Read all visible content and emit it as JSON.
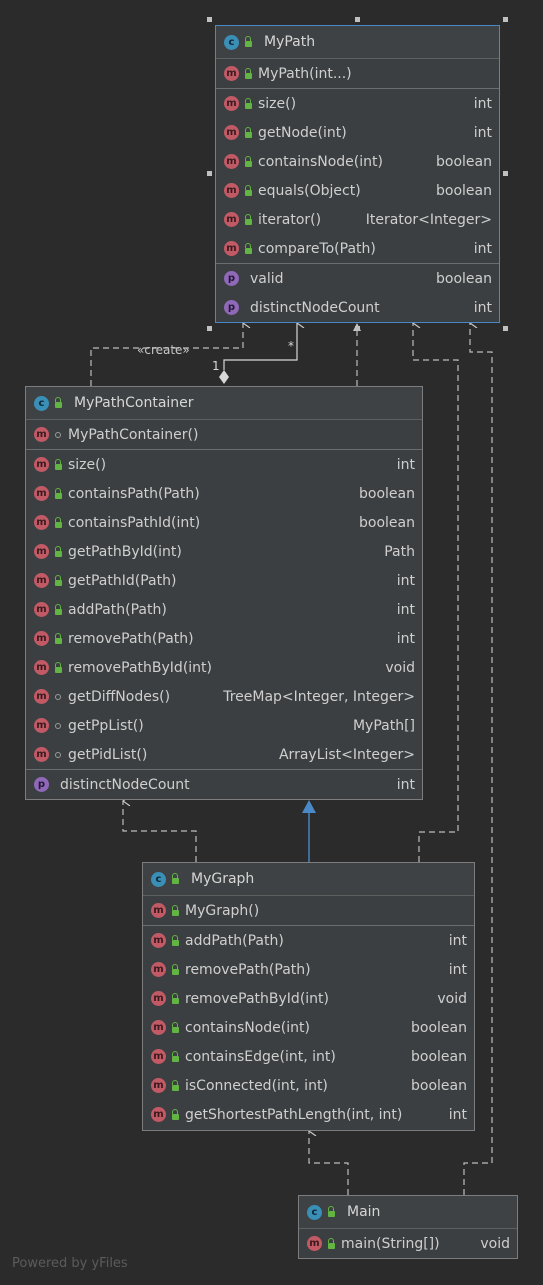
{
  "classes": {
    "mypath": {
      "name": "MyPath",
      "constructors": [
        {
          "name": "MyPath(int...)",
          "type": ""
        }
      ],
      "methods": [
        {
          "name": "size()",
          "type": "int"
        },
        {
          "name": "getNode(int)",
          "type": "int"
        },
        {
          "name": "containsNode(int)",
          "type": "boolean"
        },
        {
          "name": "equals(Object)",
          "type": "boolean"
        },
        {
          "name": "iterator()",
          "type": "Iterator<Integer>"
        },
        {
          "name": "compareTo(Path)",
          "type": "int"
        }
      ],
      "properties": [
        {
          "name": "valid",
          "type": "boolean"
        },
        {
          "name": "distinctNodeCount",
          "type": "int"
        }
      ]
    },
    "container": {
      "name": "MyPathContainer",
      "constructors": [
        {
          "name": "MyPathContainer()",
          "type": ""
        }
      ],
      "methods": [
        {
          "name": "size()",
          "type": "int"
        },
        {
          "name": "containsPath(Path)",
          "type": "boolean"
        },
        {
          "name": "containsPathId(int)",
          "type": "boolean"
        },
        {
          "name": "getPathById(int)",
          "type": "Path"
        },
        {
          "name": "getPathId(Path)",
          "type": "int"
        },
        {
          "name": "addPath(Path)",
          "type": "int"
        },
        {
          "name": "removePath(Path)",
          "type": "int"
        },
        {
          "name": "removePathById(int)",
          "type": "void"
        },
        {
          "name": "getDiffNodes()",
          "type": "TreeMap<Integer, Integer>"
        },
        {
          "name": "getPpList()",
          "type": "MyPath[]"
        },
        {
          "name": "getPidList()",
          "type": "ArrayList<Integer>"
        }
      ],
      "properties": [
        {
          "name": "distinctNodeCount",
          "type": "int"
        }
      ]
    },
    "graph": {
      "name": "MyGraph",
      "constructors": [
        {
          "name": "MyGraph()",
          "type": ""
        }
      ],
      "methods": [
        {
          "name": "addPath(Path)",
          "type": "int"
        },
        {
          "name": "removePath(Path)",
          "type": "int"
        },
        {
          "name": "removePathById(int)",
          "type": "void"
        },
        {
          "name": "containsNode(int)",
          "type": "boolean"
        },
        {
          "name": "containsEdge(int, int)",
          "type": "boolean"
        },
        {
          "name": "isConnected(int, int)",
          "type": "boolean"
        },
        {
          "name": "getShortestPathLength(int, int)",
          "type": "int"
        }
      ],
      "properties": []
    },
    "main": {
      "name": "Main",
      "constructors": [],
      "methods": [
        {
          "name": "main(String[])",
          "type": "void"
        }
      ],
      "properties": []
    }
  },
  "labels": {
    "create": "«create»",
    "multiplicity_many": "*",
    "multiplicity_one": "1"
  },
  "footer": "Powered by yFiles",
  "colors": {
    "background": "#2b2b2b",
    "class_fill": "#3c3f41",
    "selection": "#4a88c7",
    "class_badge": "#3a8fb7",
    "method_badge": "#c25a66",
    "property_badge": "#8f68b8",
    "public_lock": "#62b543"
  }
}
